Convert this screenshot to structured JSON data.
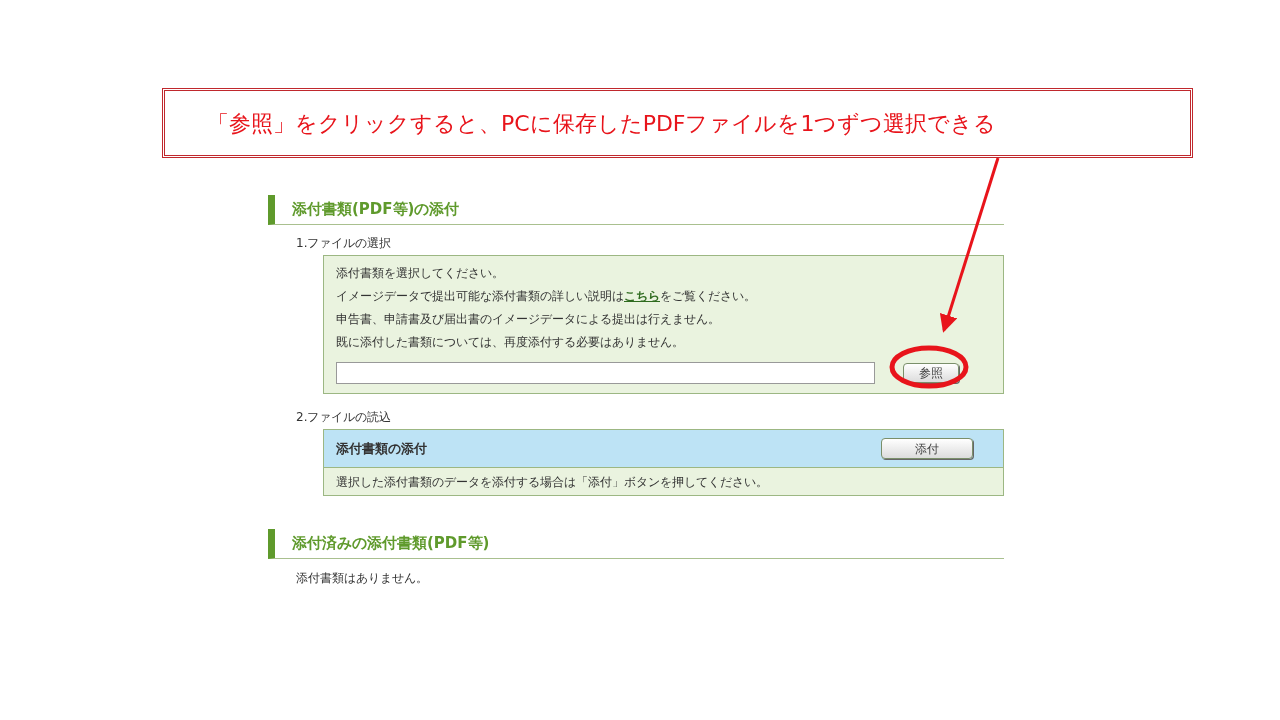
{
  "callout": {
    "text": "「参照」をクリックすると、PCに保存したPDFファイルを1つずつ選択できる"
  },
  "attach_section": {
    "heading": "添付書類(PDF等)の添付",
    "step1": {
      "label": "1.ファイルの選択",
      "lines": [
        {
          "text": "添付書類を選択してください。"
        },
        {
          "before": "イメージデータで提出可能な添付書類の詳しい説明は",
          "link": "こちら",
          "after": "をご覧ください。"
        },
        {
          "text": "申告書、申請書及び届出書のイメージデータによる提出は行えません。"
        },
        {
          "text": "既に添付した書類については、再度添付する必要はありません。"
        }
      ],
      "browse_button": "参照",
      "highlighted": true
    },
    "step2": {
      "label": "2.ファイルの読込",
      "panel_title": "添付書類の添付",
      "attach_button": "添付",
      "note": "選択した添付書類のデータを添付する場合は「添付」ボタンを押してください。"
    }
  },
  "attached_section": {
    "heading": "添付済みの添付書類(PDF等)",
    "empty_text": "添付書類はありません。"
  }
}
